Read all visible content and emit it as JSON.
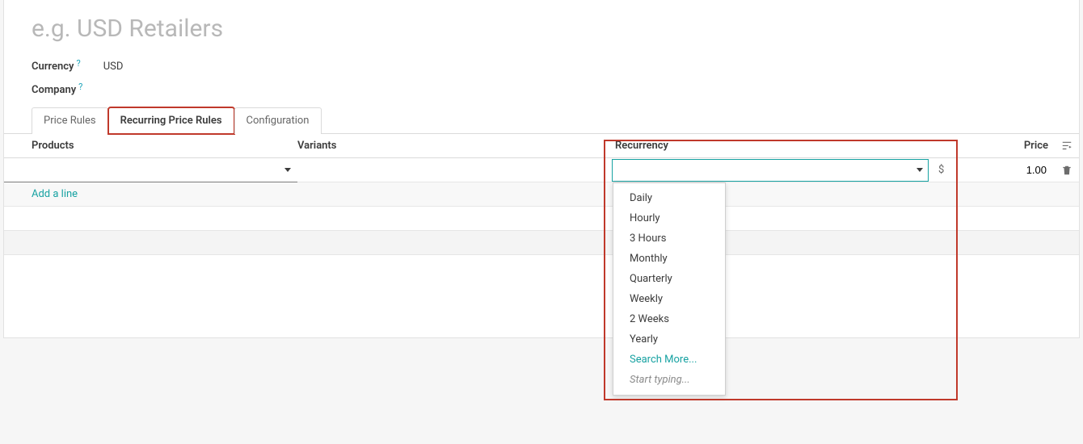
{
  "page": {
    "title_placeholder": "e.g. USD Retailers"
  },
  "fields": {
    "currency_label": "Currency",
    "currency_value": "USD",
    "company_label": "Company",
    "company_value": ""
  },
  "tabs": {
    "price_rules": "Price Rules",
    "recurring_price_rules": "Recurring Price Rules",
    "configuration": "Configuration"
  },
  "columns": {
    "products": "Products",
    "variants": "Variants",
    "recurrency": "Recurrency",
    "price": "Price"
  },
  "row": {
    "currency_symbol": "$",
    "price_value": "1.00"
  },
  "add_line": "Add a line",
  "recurrency_options": {
    "items": [
      "Daily",
      "Hourly",
      "3 Hours",
      "Monthly",
      "Quarterly",
      "Weekly",
      "2 Weeks",
      "Yearly"
    ],
    "search_more": "Search More...",
    "start_typing": "Start typing..."
  }
}
